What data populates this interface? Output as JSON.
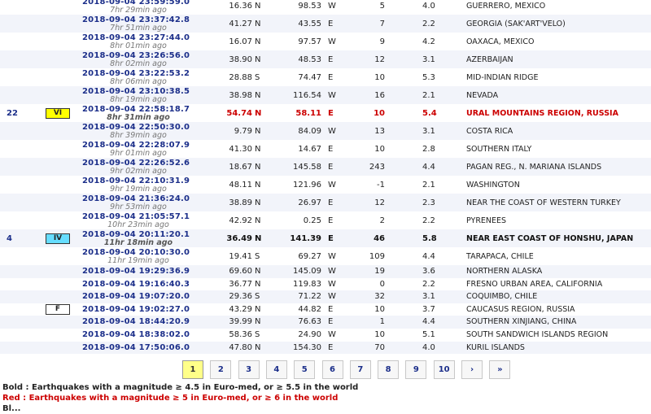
{
  "rows": [
    {
      "num": "",
      "intensity": "",
      "datetime": "2018-09-04   23:59:59.0",
      "ago": "7hr 29min ago",
      "lat": "16.36",
      "ns": "N",
      "lon": "98.53",
      "ew": "W",
      "depth": "5",
      "mag": "4.0",
      "region": "GUERRERO, MEXICO",
      "style": "normal"
    },
    {
      "num": "",
      "intensity": "",
      "datetime": "2018-09-04   23:37:42.8",
      "ago": "7hr 51min ago",
      "lat": "41.27",
      "ns": "N",
      "lon": "43.55",
      "ew": "E",
      "depth": "7",
      "mag": "2.2",
      "region": "GEORGIA (SAK'ART'VELO)",
      "style": "normal"
    },
    {
      "num": "",
      "intensity": "",
      "datetime": "2018-09-04   23:27:44.0",
      "ago": "8hr 01min ago",
      "lat": "16.07",
      "ns": "N",
      "lon": "97.57",
      "ew": "W",
      "depth": "9",
      "mag": "4.2",
      "region": "OAXACA, MEXICO",
      "style": "normal"
    },
    {
      "num": "",
      "intensity": "",
      "datetime": "2018-09-04   23:26:56.0",
      "ago": "8hr 02min ago",
      "lat": "38.90",
      "ns": "N",
      "lon": "48.53",
      "ew": "E",
      "depth": "12",
      "mag": "3.1",
      "region": "AZERBAIJAN",
      "style": "normal"
    },
    {
      "num": "",
      "intensity": "",
      "datetime": "2018-09-04   23:22:53.2",
      "ago": "8hr 06min ago",
      "lat": "28.88",
      "ns": "S",
      "lon": "74.47",
      "ew": "E",
      "depth": "10",
      "mag": "5.3",
      "region": "MID-INDIAN RIDGE",
      "style": "normal"
    },
    {
      "num": "",
      "intensity": "",
      "datetime": "2018-09-04   23:10:38.5",
      "ago": "8hr 19min ago",
      "lat": "38.98",
      "ns": "N",
      "lon": "116.54",
      "ew": "W",
      "depth": "16",
      "mag": "2.1",
      "region": "NEVADA",
      "style": "normal"
    },
    {
      "num": "22",
      "intensity": "VI",
      "datetime": "2018-09-04   22:58:18.7",
      "ago": "8hr 31min ago",
      "lat": "54.74",
      "ns": "N",
      "lon": "58.11",
      "ew": "E",
      "depth": "10",
      "mag": "5.4",
      "region": "URAL MOUNTAINS REGION, RUSSIA",
      "style": "red"
    },
    {
      "num": "",
      "intensity": "",
      "datetime": "2018-09-04   22:50:30.0",
      "ago": "8hr 39min ago",
      "lat": "9.79",
      "ns": "N",
      "lon": "84.09",
      "ew": "W",
      "depth": "13",
      "mag": "3.1",
      "region": "COSTA RICA",
      "style": "normal"
    },
    {
      "num": "",
      "intensity": "",
      "datetime": "2018-09-04   22:28:07.9",
      "ago": "9hr 01min ago",
      "lat": "41.30",
      "ns": "N",
      "lon": "14.67",
      "ew": "E",
      "depth": "10",
      "mag": "2.8",
      "region": "SOUTHERN ITALY",
      "style": "normal"
    },
    {
      "num": "",
      "intensity": "",
      "datetime": "2018-09-04   22:26:52.6",
      "ago": "9hr 02min ago",
      "lat": "18.67",
      "ns": "N",
      "lon": "145.58",
      "ew": "E",
      "depth": "243",
      "mag": "4.4",
      "region": "PAGAN REG., N. MARIANA ISLANDS",
      "style": "normal"
    },
    {
      "num": "",
      "intensity": "",
      "datetime": "2018-09-04   22:10:31.9",
      "ago": "9hr 19min ago",
      "lat": "48.11",
      "ns": "N",
      "lon": "121.96",
      "ew": "W",
      "depth": "-1",
      "mag": "2.1",
      "region": "WASHINGTON",
      "style": "normal"
    },
    {
      "num": "",
      "intensity": "",
      "datetime": "2018-09-04   21:36:24.0",
      "ago": "9hr 53min ago",
      "lat": "38.89",
      "ns": "N",
      "lon": "26.97",
      "ew": "E",
      "depth": "12",
      "mag": "2.3",
      "region": "NEAR THE COAST OF WESTERN TURKEY",
      "style": "normal"
    },
    {
      "num": "",
      "intensity": "",
      "datetime": "2018-09-04   21:05:57.1",
      "ago": "10hr 23min ago",
      "lat": "42.92",
      "ns": "N",
      "lon": "0.25",
      "ew": "E",
      "depth": "2",
      "mag": "2.2",
      "region": "PYRENEES",
      "style": "normal"
    },
    {
      "num": "4",
      "intensity": "IV",
      "datetime": "2018-09-04   20:11:20.1",
      "ago": "11hr 18min ago",
      "lat": "36.49",
      "ns": "N",
      "lon": "141.39",
      "ew": "E",
      "depth": "46",
      "mag": "5.8",
      "region": "NEAR EAST COAST OF HONSHU, JAPAN",
      "style": "bold"
    },
    {
      "num": "",
      "intensity": "",
      "datetime": "2018-09-04   20:10:30.0",
      "ago": "11hr 19min ago",
      "lat": "19.41",
      "ns": "S",
      "lon": "69.27",
      "ew": "W",
      "depth": "109",
      "mag": "4.4",
      "region": "TARAPACA, CHILE",
      "style": "normal"
    },
    {
      "num": "",
      "intensity": "",
      "datetime": "2018-09-04   19:29:36.9",
      "ago": "",
      "lat": "69.60",
      "ns": "N",
      "lon": "145.09",
      "ew": "W",
      "depth": "19",
      "mag": "3.6",
      "region": "NORTHERN ALASKA",
      "style": "normal"
    },
    {
      "num": "",
      "intensity": "",
      "datetime": "2018-09-04   19:16:40.3",
      "ago": "",
      "lat": "36.77",
      "ns": "N",
      "lon": "119.83",
      "ew": "W",
      "depth": "0",
      "mag": "2.2",
      "region": "FRESNO URBAN AREA, CALIFORNIA",
      "style": "normal"
    },
    {
      "num": "",
      "intensity": "",
      "datetime": "2018-09-04   19:07:20.0",
      "ago": "",
      "lat": "29.36",
      "ns": "S",
      "lon": "71.22",
      "ew": "W",
      "depth": "32",
      "mag": "3.1",
      "region": "COQUIMBO, CHILE",
      "style": "normal"
    },
    {
      "num": "",
      "intensity": "F",
      "datetime": "2018-09-04   19:02:27.0",
      "ago": "",
      "lat": "43.29",
      "ns": "N",
      "lon": "44.82",
      "ew": "E",
      "depth": "10",
      "mag": "3.7",
      "region": "CAUCASUS REGION, RUSSIA",
      "style": "normal"
    },
    {
      "num": "",
      "intensity": "",
      "datetime": "2018-09-04   18:44:20.9",
      "ago": "",
      "lat": "39.99",
      "ns": "N",
      "lon": "76.63",
      "ew": "E",
      "depth": "1",
      "mag": "4.4",
      "region": "SOUTHERN XINJIANG, CHINA",
      "style": "normal"
    },
    {
      "num": "",
      "intensity": "",
      "datetime": "2018-09-04   18:38:02.0",
      "ago": "",
      "lat": "58.36",
      "ns": "S",
      "lon": "24.90",
      "ew": "W",
      "depth": "10",
      "mag": "5.1",
      "region": "SOUTH SANDWICH ISLANDS REGION",
      "style": "normal"
    },
    {
      "num": "",
      "intensity": "",
      "datetime": "2018-09-04   17:50:06.0",
      "ago": "",
      "lat": "47.80",
      "ns": "N",
      "lon": "154.30",
      "ew": "E",
      "depth": "70",
      "mag": "4.0",
      "region": "KURIL ISLANDS",
      "style": "normal"
    }
  ],
  "pager": [
    "1",
    "2",
    "3",
    "4",
    "5",
    "6",
    "7",
    "8",
    "9",
    "10",
    "›",
    "»"
  ],
  "pager_active": "1",
  "legend": {
    "bold": "Bold : Earthquakes with a magnitude ≥ 4.5 in Euro-med, or ≥ 5.5 in the world",
    "red": "Red : Earthquakes with a magnitude ≥ 5 in Euro-med, or ≥ 6 in the world",
    "partial": "Bl..."
  },
  "colors": {
    "link": "#1c2f8a",
    "red": "#cc0000",
    "row_alt": "#f2f4fa",
    "intensity_VI": "#ffff00",
    "intensity_IV": "#66ddff",
    "pager_active": "#ffff88"
  }
}
